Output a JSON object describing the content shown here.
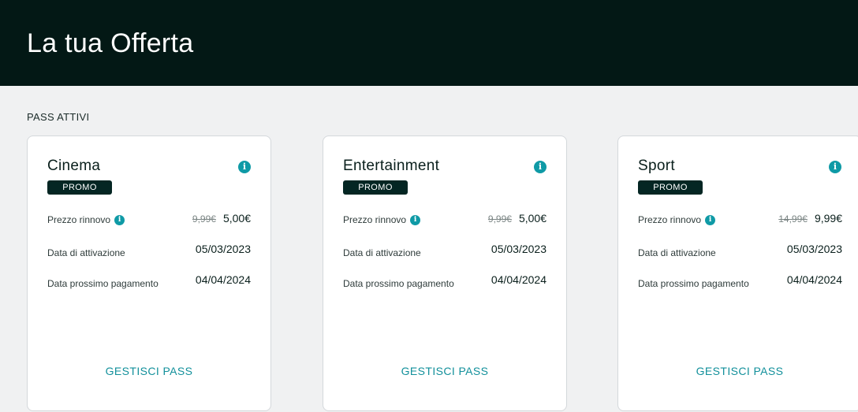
{
  "header": {
    "title": "La tua Offerta"
  },
  "section": {
    "label": "PASS ATTIVI"
  },
  "colors": {
    "header_bg": "#031815",
    "accent": "#0f9aa6",
    "badge_bg": "#042623"
  },
  "icons": {
    "info": "info-icon"
  },
  "cards": [
    {
      "title": "Cinema",
      "badge": "PROMO",
      "renewal_label": "Prezzo rinnovo",
      "renewal_old_price": "9,99€",
      "renewal_price": "5,00€",
      "activation_label": "Data di attivazione",
      "activation_date": "05/03/2023",
      "next_payment_label": "Data prossimo pagamento",
      "next_payment_date": "04/04/2024",
      "manage_label": "GESTISCI PASS"
    },
    {
      "title": "Entertainment",
      "badge": "PROMO",
      "renewal_label": "Prezzo rinnovo",
      "renewal_old_price": "9,99€",
      "renewal_price": "5,00€",
      "activation_label": "Data di attivazione",
      "activation_date": "05/03/2023",
      "next_payment_label": "Data prossimo pagamento",
      "next_payment_date": "04/04/2024",
      "manage_label": "GESTISCI PASS"
    },
    {
      "title": "Sport",
      "badge": "PROMO",
      "renewal_label": "Prezzo rinnovo",
      "renewal_old_price": "14,99€",
      "renewal_price": "9,99€",
      "activation_label": "Data di attivazione",
      "activation_date": "05/03/2023",
      "next_payment_label": "Data prossimo pagamento",
      "next_payment_date": "04/04/2024",
      "manage_label": "GESTISCI PASS"
    }
  ]
}
